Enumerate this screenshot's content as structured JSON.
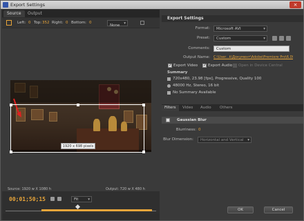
{
  "window": {
    "title": "Export Settings",
    "close_label": "×"
  },
  "left": {
    "tabs": [
      "Source",
      "Output"
    ],
    "crop": {
      "left_label": "Left:",
      "left_value": "0",
      "top_label": "Top:",
      "top_value": "352",
      "right_label": "Right:",
      "right_value": "0",
      "bottom_label": "Bottom:",
      "bottom_value": "0",
      "preset_value": "None"
    },
    "crop_size_label": "1920 x 698 pixels",
    "source_info": "Source: 1920 w X 1080 h",
    "output_info": "Output: 720 w X 480 h",
    "timecode": "00;01;50;15",
    "fit_value": "Fit"
  },
  "right": {
    "section_title": "Export Settings",
    "format_label": "Format:",
    "format_value": "Microsoft AVI",
    "preset_label": "Preset:",
    "preset_value": "Custom",
    "comments_label": "Comments:",
    "comments_value": "Custom",
    "output_name_label": "Output Name:",
    "output_name_value": "C:\\User...k\\Документ\\Adobe\\Premiere Pro\\6.0\\Sequence 01.avi",
    "export_video_label": "Export Video",
    "export_audio_label": "Export Audio",
    "open_in_device_label": "Open in Device Central",
    "summary_title": "Summary",
    "summary_video": "720x480, 23.98 [fps], Progressive, Quality 100",
    "summary_audio": "48000 Hz, Stereo, 16 bit",
    "summary_other": "No Summary Available",
    "filter_tabs": [
      "Filters",
      "Video",
      "Audio",
      "Others"
    ],
    "effect_title": "Gaussian Blur",
    "blurriness_label": "Blurriness:",
    "blurriness_value": "0",
    "blur_dimension_label": "Blur Dimension:",
    "blur_dimension_value": "Horizontal and Vertical",
    "ok_label": "OK",
    "cancel_label": "Cancel"
  }
}
